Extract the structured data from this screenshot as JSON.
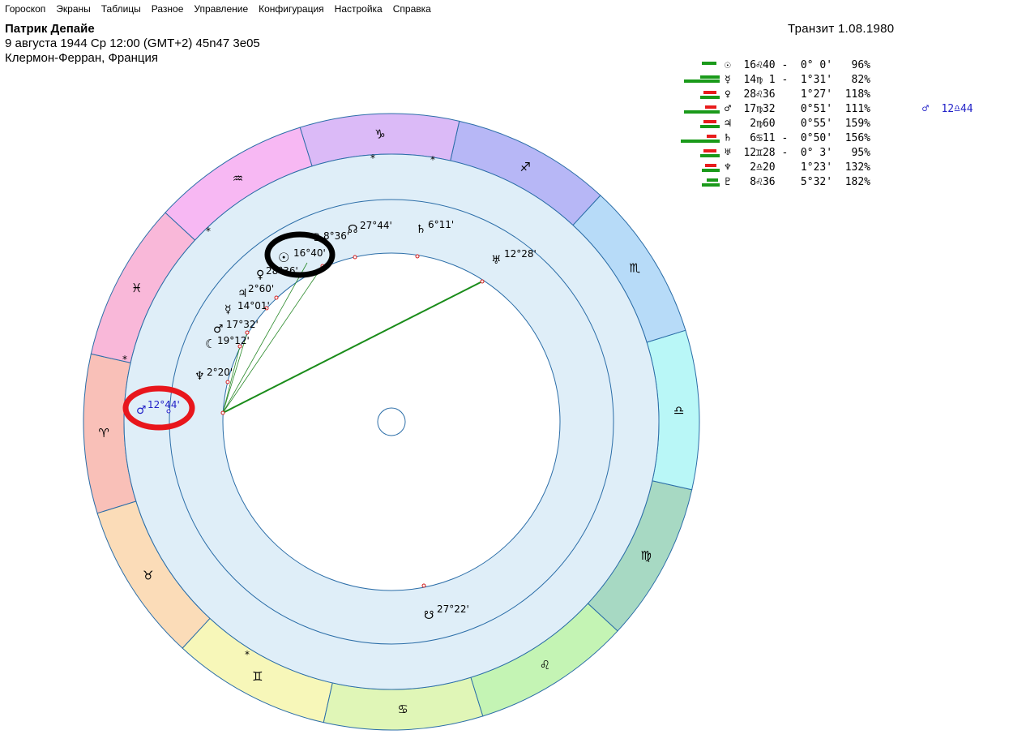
{
  "menu": [
    "Гороскоп",
    "Экраны",
    "Таблицы",
    "Разное",
    "Управление",
    "Конфигурация",
    "Настройка",
    "Справка"
  ],
  "person": {
    "name": "Патрик Депайе",
    "birth_line": "9 августа 1944  Ср  12:00 (GMT+2) 45n47  3e05",
    "place": "Клермон-Ферран, Франция"
  },
  "transit": {
    "title": "Транзит  1.08.1980"
  },
  "aspects": [
    {
      "text": "☉  16♌40 -  0° 0'   96%",
      "bars": "g-top"
    },
    {
      "text": "☿  14♍ 1 -  1°31'   82%",
      "bars": "g-long"
    },
    {
      "text": "♀  28♌36    1°27'  118%",
      "bars": "rg"
    },
    {
      "text": "♂  17♍32    0°51'  111%",
      "bars": "rgl",
      "extra": "♂  12♎44"
    },
    {
      "text": "♃   2♍60    0°55'  159%",
      "bars": "rg"
    },
    {
      "text": "♄   6♋11 -  0°50'  156%",
      "bars": "rgl2"
    },
    {
      "text": "♅  12♊28 -  0° 3'   95%",
      "bars": "rg"
    },
    {
      "text": "♆   2♎20    1°23'  132%",
      "bars": "rg2"
    },
    {
      "text": "♇   8♌36    5°32'  182%",
      "bars": "g2"
    }
  ],
  "signs": [
    {
      "glyph": "♈",
      "color": "#f9c0b8"
    },
    {
      "glyph": "♉",
      "color": "#fbdcb8"
    },
    {
      "glyph": "♊",
      "color": "#f7f7b9"
    },
    {
      "glyph": "♋",
      "color": "#e0f6b7"
    },
    {
      "glyph": "♌",
      "color": "#c4f4b4"
    },
    {
      "glyph": "♍",
      "color": "#a7d9c3"
    },
    {
      "glyph": "♎",
      "color": "#b9f7f7"
    },
    {
      "glyph": "♏",
      "color": "#b7dbf8"
    },
    {
      "glyph": "♐",
      "color": "#b7b7f6"
    },
    {
      "glyph": "♑",
      "color": "#dbbaf7"
    },
    {
      "glyph": "♒",
      "color": "#f7b8f3"
    },
    {
      "glyph": "♓",
      "color": "#f9b8d9"
    }
  ],
  "natal_planets": [
    {
      "glyph": "☉",
      "label": "16°40'"
    },
    {
      "glyph": "♇",
      "label": "8°36'"
    },
    {
      "glyph": "☊",
      "label": "27°44'"
    },
    {
      "glyph": "♄",
      "label": "6°11'"
    },
    {
      "glyph": "♅",
      "label": "12°28'"
    },
    {
      "glyph": "♀",
      "label": "28°36'"
    },
    {
      "glyph": "♃",
      "label": "2°60'"
    },
    {
      "glyph": "☿",
      "label": "14°01'"
    },
    {
      "glyph": "♂",
      "label": "17°32'"
    },
    {
      "glyph": "☾",
      "label": "19°12'"
    },
    {
      "glyph": "♆",
      "label": "2°20'"
    },
    {
      "glyph": "☋",
      "label": "27°22'"
    }
  ],
  "transit_planet": {
    "glyph": "♂",
    "label": "12°44'"
  },
  "colors": {
    "ring_blue": "#dfeef8",
    "circle_line": "#2c6ea8",
    "aspect_green": "#1a8c1a",
    "highlight_black": "#000000",
    "highlight_red": "#e8161c",
    "transit_blue": "#2323c8"
  }
}
